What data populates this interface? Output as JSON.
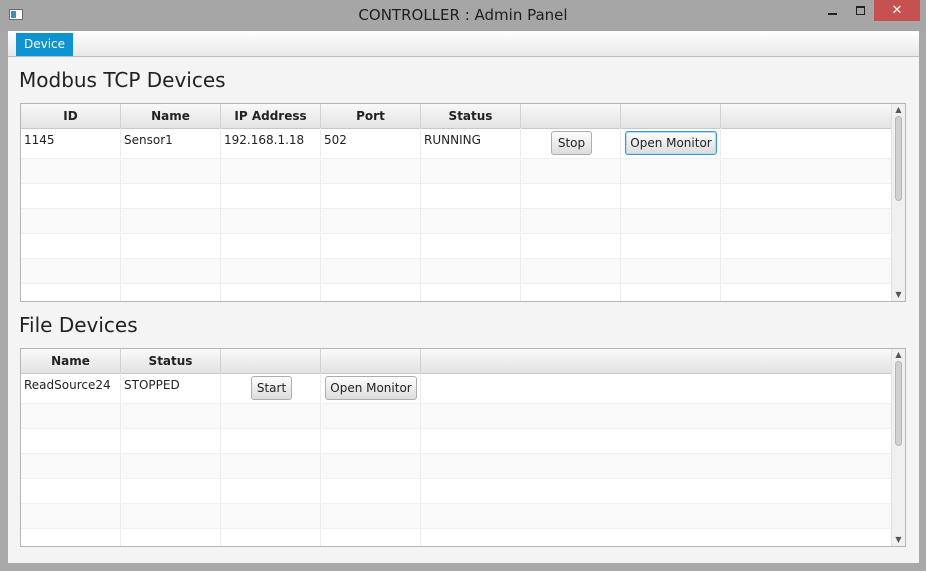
{
  "window": {
    "title": "CONTROLLER : Admin Panel",
    "close_glyph": "✕",
    "accent": "#0d93d0",
    "close_color": "#c75050"
  },
  "menubar": {
    "items": [
      {
        "label": "Device",
        "selected": true
      }
    ]
  },
  "modbus": {
    "title": "Modbus TCP Devices",
    "columns": [
      "ID",
      "Name",
      "IP Address",
      "Port",
      "Status",
      "",
      ""
    ],
    "rows": [
      {
        "id": "1145",
        "name": "Sensor1",
        "ip": "192.168.1.18",
        "port": "502",
        "status": "RUNNING",
        "action_label": "Stop",
        "monitor_label": "Open Monitor"
      }
    ]
  },
  "files": {
    "title": "File Devices",
    "columns": [
      "Name",
      "Status",
      "",
      ""
    ],
    "rows": [
      {
        "name": "ReadSource24",
        "status": "STOPPED",
        "action_label": "Start",
        "monitor_label": "Open Monitor"
      }
    ]
  },
  "icons": {
    "scroll_up": "▲",
    "scroll_down": "▼"
  }
}
